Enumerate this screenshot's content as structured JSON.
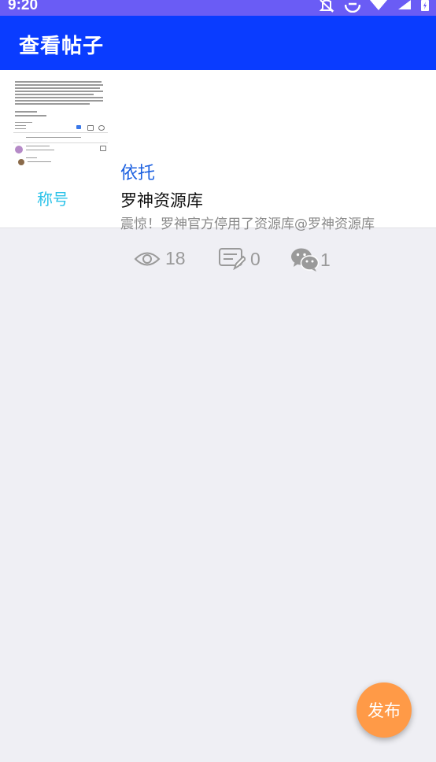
{
  "status_bar": {
    "time": "9:20"
  },
  "app_bar": {
    "title": "查看帖子"
  },
  "post": {
    "author_tag": "称号",
    "category": "依托",
    "title": "罗神资源库",
    "excerpt": "震惊！罗神官方停用了资源库@罗神资源库",
    "views": "18",
    "comments": "0",
    "wechat": "1"
  },
  "fab": {
    "label": "发布"
  },
  "colors": {
    "status_bar": "#6a5cf5",
    "app_bar": "#0a3cff",
    "category": "#1a5fe0",
    "author_tag": "#2ec3e9",
    "fab": "#ff9a47"
  }
}
